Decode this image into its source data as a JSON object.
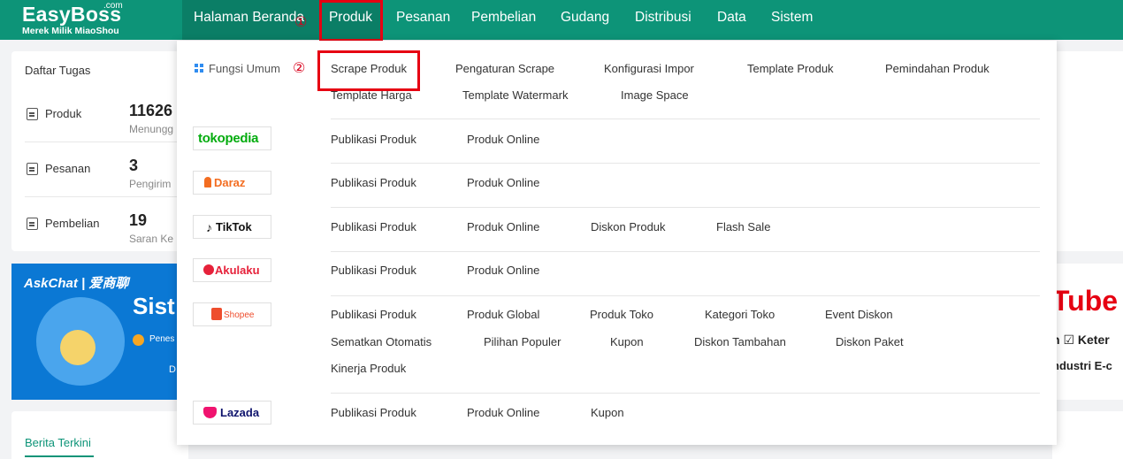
{
  "logo": {
    "brand": "EasyBoss",
    "com": ".com",
    "sub": "Merek Milik MiaoShou"
  },
  "nav": [
    "Halaman Beranda",
    "Produk",
    "Pesanan",
    "Pembelian",
    "Gudang",
    "Distribusi",
    "Data",
    "Sistem"
  ],
  "annotations": {
    "step1": "①",
    "step2": "②"
  },
  "tasks": {
    "title": "Daftar Tugas",
    "rows": [
      {
        "label": "Produk",
        "value": "11626",
        "sub": "Menungg"
      },
      {
        "label": "Pesanan",
        "value": "3",
        "sub": "Pengirim"
      },
      {
        "label": "Pembelian",
        "value": "19",
        "sub": "Saran Ke"
      }
    ]
  },
  "banner": {
    "title": "AskChat | 爱商聊",
    "big": "Sist",
    "small": "Penes",
    "d": "D"
  },
  "right_banner": {
    "tube": "Tube I",
    "ket": "n  ☑ Keter",
    "ind": "ndustri  E-c"
  },
  "news": {
    "tab": "Berita Terkini"
  },
  "dropdown": {
    "general_label": "Fungsi Umum",
    "general_row1": [
      "Scrape Produk",
      "Pengaturan Scrape",
      "Konfigurasi Impor",
      "Template Produk",
      "Pemindahan Produk"
    ],
    "general_row2": [
      "Template Harga",
      "Template Watermark",
      "Image Space"
    ],
    "platforms": {
      "tokopedia": {
        "logo": "tokopedia",
        "items": [
          "Publikasi Produk",
          "Produk Online"
        ]
      },
      "daraz": {
        "logo": "Daraz",
        "items": [
          "Publikasi Produk",
          "Produk Online"
        ]
      },
      "tiktok": {
        "logo": "TikTok",
        "items": [
          "Publikasi Produk",
          "Produk Online",
          "Diskon Produk",
          "Flash Sale"
        ]
      },
      "akulaku": {
        "logo": "Akulaku",
        "items": [
          "Publikasi Produk",
          "Produk Online"
        ]
      },
      "shopee": {
        "logo": "Shopee",
        "row1": [
          "Publikasi Produk",
          "Produk Global",
          "Produk Toko",
          "Kategori Toko",
          "Event Diskon"
        ],
        "row2": [
          "Sematkan Otomatis",
          "Pilihan Populer",
          "Kupon",
          "Diskon Tambahan",
          "Diskon Paket"
        ],
        "row3": [
          "Kinerja Produk"
        ]
      },
      "lazada": {
        "logo": "Lazada",
        "items": [
          "Publikasi Produk",
          "Produk Online",
          "Kupon"
        ]
      }
    }
  },
  "colors": {
    "brand": "#0d9478",
    "highlight": "#e60012"
  }
}
